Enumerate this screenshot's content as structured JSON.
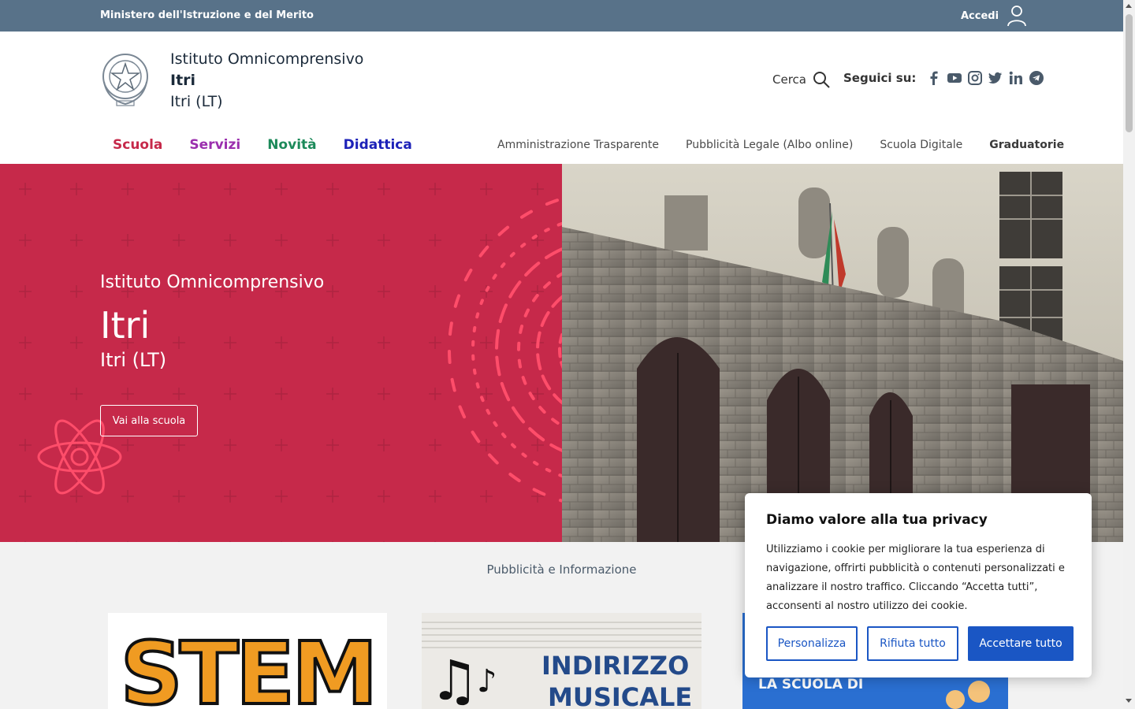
{
  "topbar": {
    "ministry": "Ministero dell'Istruzione e del Merito",
    "login_label": "Accedi"
  },
  "header": {
    "brand_line1": "Istituto Omnicomprensivo",
    "brand_line2": "Itri",
    "brand_line3": "Itri (LT)",
    "search_label": "Cerca",
    "social_label": "Seguici su:",
    "social_icons": [
      "facebook-icon",
      "youtube-icon",
      "instagram-icon",
      "twitter-icon",
      "linkedin-icon",
      "telegram-icon"
    ]
  },
  "mainnav": [
    {
      "label": "Scuola",
      "color": "#c6294a"
    },
    {
      "label": "Servizi",
      "color": "#9b2fae"
    },
    {
      "label": "Novità",
      "color": "#1c8a5a"
    },
    {
      "label": "Didattica",
      "color": "#1d22b8"
    }
  ],
  "subnav": [
    "Amministrazione Trasparente",
    "Pubblicità Legale (Albo online)",
    "Scuola Digitale",
    "Graduatorie"
  ],
  "hero": {
    "line1": "Istituto Omnicomprensivo",
    "line2": "Itri",
    "line3": "Itri (LT)",
    "button": "Vai alla scuola",
    "bg_color": "#c6294a"
  },
  "section": {
    "title": "Pubblicità e Informazione"
  },
  "cards": [
    {
      "text": "STEM"
    },
    {
      "text1": "INDIRIZZO",
      "text2": "MUSICALE"
    },
    {
      "text": "LA SCUOLA DI"
    }
  ],
  "cookie": {
    "title": "Diamo valore alla tua privacy",
    "body": "Utilizziamo i cookie per migliorare la tua esperienza di navigazione, offrirti pubblicità o contenuti personalizzati e analizzare il nostro traffico. Cliccando “Accetta tutti”, acconsenti al nostro utilizzo dei cookie.",
    "btn_customize": "Personalizza",
    "btn_reject": "Rifiuta tutto",
    "btn_accept": "Accettare tutto"
  },
  "colors": {
    "topbar": "#587289",
    "accent_blue": "#1a56c4"
  }
}
